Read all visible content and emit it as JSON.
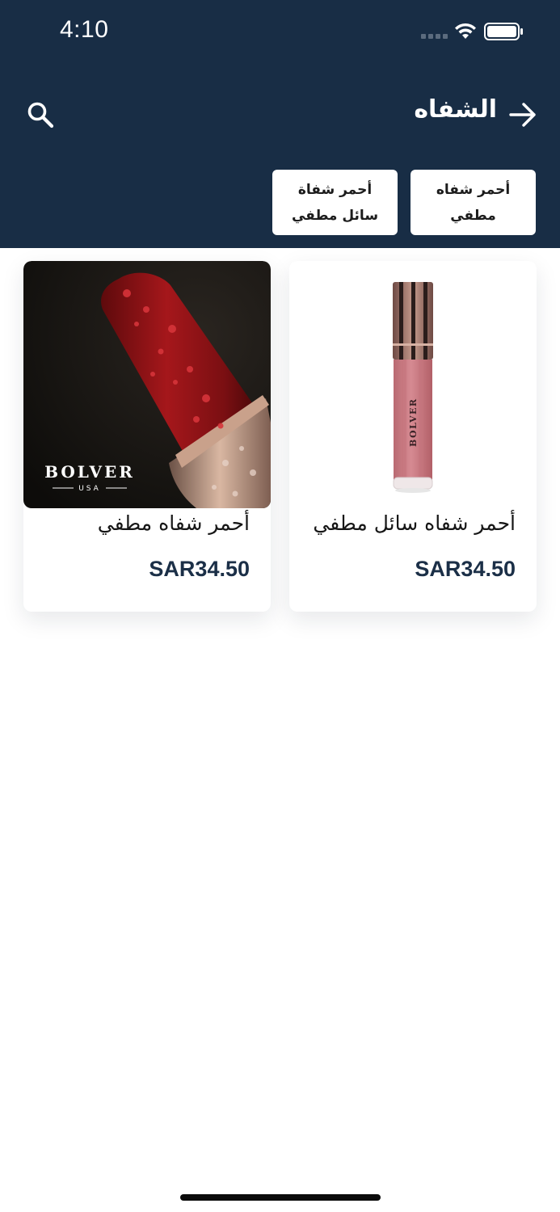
{
  "status_bar": {
    "time": "4:10"
  },
  "header": {
    "title": "الشفاه",
    "back_icon": "arrow-right-icon",
    "search_icon": "search-icon"
  },
  "filters": [
    {
      "label": "أحمر شفاه\nمطفي"
    },
    {
      "label": "أحمر شفاة\nسائل مطفي"
    }
  ],
  "products": [
    {
      "name": "أحمر شفاه سائل مطفي",
      "price": "SAR34.50",
      "brand_mark": "BOLVER"
    },
    {
      "name": "أحمر شفاه مطفي",
      "price": "SAR34.50",
      "brand_mark": "BOLVER",
      "brand_sub": "USA"
    }
  ],
  "colors": {
    "header_bg": "#182d45",
    "price": "#1b2f47"
  }
}
